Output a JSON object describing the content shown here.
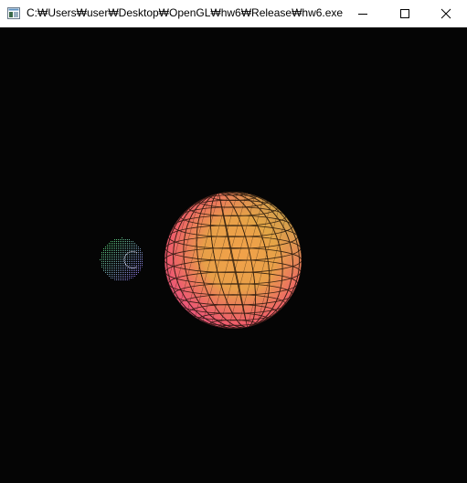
{
  "window": {
    "title": "C:₩Users₩user₩Desktop₩OpenGL₩hw6₩Release₩hw6.exe",
    "icon": "console-window-icon",
    "controls": {
      "minimize_icon": "minimize-icon",
      "maximize_icon": "maximize-icon",
      "close_icon": "close-icon"
    }
  },
  "scene": {
    "background_color": "#050505",
    "objects": [
      {
        "name": "large-sphere",
        "render": "wireframe-gradient",
        "colors": [
          "#b9e04a",
          "#f0a046",
          "#f0507a",
          "#d04fb0"
        ]
      },
      {
        "name": "small-sphere",
        "render": "dotted-gradient",
        "colors": [
          "#4fd06a",
          "#3f8fe0",
          "#8060f0"
        ]
      }
    ]
  }
}
